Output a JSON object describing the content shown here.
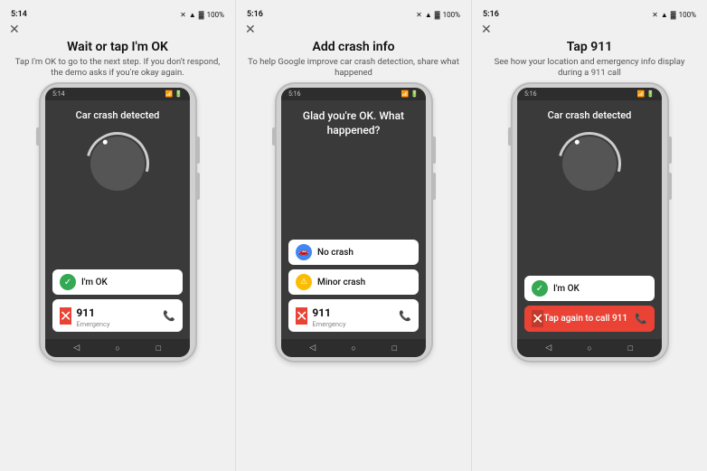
{
  "panels": [
    {
      "id": "panel1",
      "status_time": "5:14",
      "status_icons": "▷ ⚡",
      "battery": "100%",
      "title": "Wait or tap I'm OK",
      "description": "Tap I'm OK to go to the next step. If you don't respond, the demo asks if you're okay again.",
      "screen": {
        "top_text": "Car crash detected",
        "has_spinner": true,
        "buttons": [
          {
            "type": "ok",
            "label": "I'm OK",
            "icon_type": "green",
            "icon": "✓"
          },
          {
            "type": "911",
            "number": "911",
            "sub": "Emergency"
          }
        ]
      }
    },
    {
      "id": "panel2",
      "status_time": "5:16",
      "status_icons": "▷ ⚡",
      "battery": "100%",
      "title": "Add crash info",
      "description": "To help Google improve car crash detection, share what happened",
      "screen": {
        "top_text": "Glad you're OK. What happened?",
        "has_spinner": false,
        "crash_options": [
          {
            "label": "No crash",
            "icon_type": "blue",
            "icon": "🚗"
          },
          {
            "label": "Minor crash",
            "icon_type": "yellow",
            "icon": "⚠"
          }
        ],
        "buttons": [
          {
            "type": "911",
            "number": "911",
            "sub": "Emergency"
          }
        ]
      }
    },
    {
      "id": "panel3",
      "status_time": "5:16",
      "status_icons": "▷ ⚡",
      "battery": "100%",
      "title": "Tap 911",
      "description": "See how your location and emergency info display during a 911 call",
      "screen": {
        "top_text": "Car crash detected",
        "has_spinner": true,
        "buttons": [
          {
            "type": "ok",
            "label": "I'm OK",
            "icon_type": "green",
            "icon": "✓"
          },
          {
            "type": "911_active",
            "label": "Tap again to call 911"
          }
        ]
      }
    }
  ]
}
